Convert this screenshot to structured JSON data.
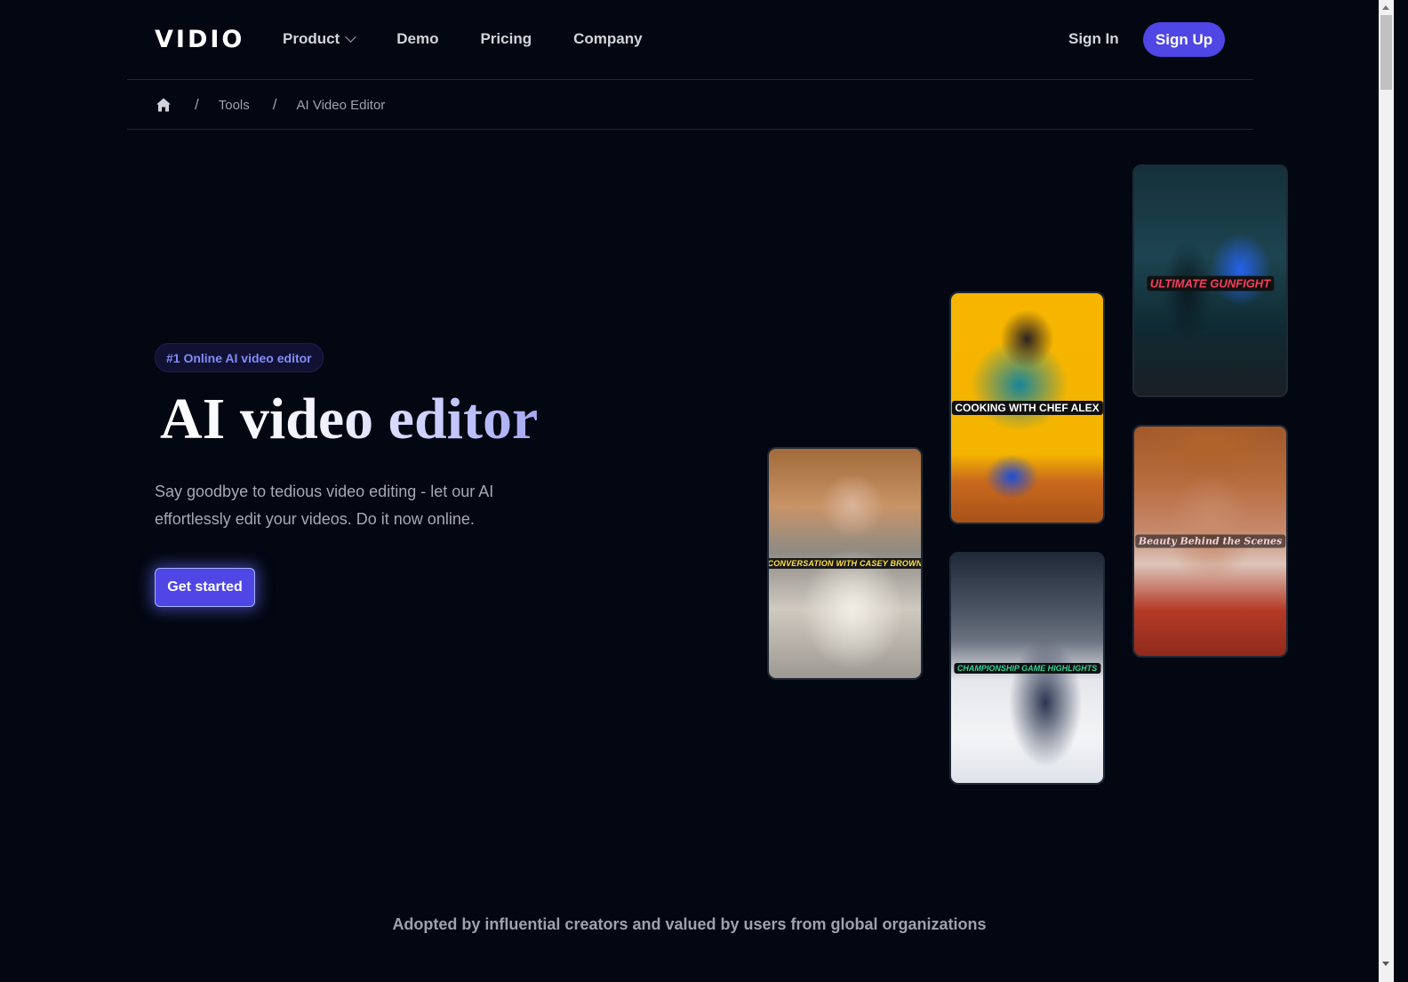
{
  "header": {
    "logo": "VIDIO",
    "nav": [
      {
        "label": "Product",
        "has_dropdown": true
      },
      {
        "label": "Demo"
      },
      {
        "label": "Pricing"
      },
      {
        "label": "Company"
      }
    ],
    "sign_in": "Sign In",
    "sign_up": "Sign Up"
  },
  "breadcrumb": {
    "home_icon": "home-icon",
    "separator": "/",
    "items": [
      "Tools",
      "AI Video Editor"
    ]
  },
  "hero": {
    "badge": "#1 Online AI video editor",
    "title": "AI video editor",
    "subtitle": "Say goodbye to tedious video editing - let our AI effortlessly edit your videos. Do it now online.",
    "cta": "Get started"
  },
  "video_cards": [
    {
      "caption": "CONVERSATION WITH CASEY BROWN",
      "scene": "woman on podcast microphone"
    },
    {
      "caption": "COOKING WITH CHEF ALEX",
      "scene": "chef plating food on yellow background"
    },
    {
      "caption": "CHAMPIONSHIP GAME HIGHLIGHTS",
      "scene": "ice hockey game"
    },
    {
      "caption": "ULTIMATE GUNFIGHT",
      "scene": "gamer in front of screen"
    },
    {
      "caption": "Beauty Behind the Scenes",
      "scene": "woman in straw hat"
    }
  ],
  "footer": {
    "adopted_text": "Adopted by influential creators and valued by users from global organizations"
  },
  "colors": {
    "background": "#030712",
    "accent": "#4f46e5",
    "badge_text": "#818cf8"
  }
}
